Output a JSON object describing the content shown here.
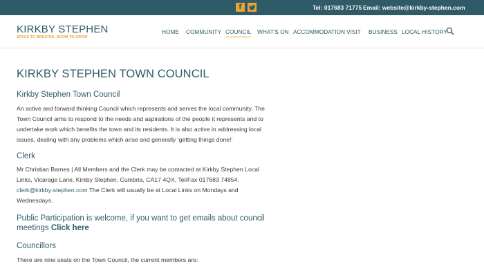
{
  "topbar": {
    "facebook_glyph": "f",
    "twitter_glyph": "t",
    "tel": "Tel: 017683 71775",
    "email": "Email: website@kirkby-stephen.com",
    "colors": {
      "bar": "#2f5b68",
      "icon_bg": "#e9a431"
    }
  },
  "header": {
    "logo_main": "KIRKBY STEPHEN",
    "logo_tagline": "SPACE TO BREATHE, ROOM TO GROW",
    "nav": [
      {
        "label": "HOME"
      },
      {
        "label": "COMMUNITY"
      },
      {
        "label": "COUNCIL",
        "active": true
      },
      {
        "label": "WHAT'S ON"
      },
      {
        "label": "ACCOMMODATION"
      },
      {
        "label": "VISIT"
      },
      {
        "label": "BUSINESS"
      },
      {
        "label": "LOCAL HISTORY"
      }
    ],
    "search_icon": "search-icon"
  },
  "main": {
    "page_title": "KIRKBY STEPHEN TOWN COUNCIL",
    "intro_heading": "Kirkby Stephen Town Council",
    "intro_lines": [
      "An active and forward thinking Council which represents and serves the local community. The",
      "Town Council aims to respond to the needs and aspirations of the people it represents and to",
      "undertake work which benefits the town and its residents. It is also active in addressing local",
      "issues, dealing with any problems which arise and generally ‘getting things done!’"
    ],
    "clerk_heading": "Clerk",
    "clerk_lines": [
      "Mr Christian Barnes | All Members and the Clerk may be contacted at Kirkby Stephen Local",
      "Links, Vicarage Lane, Kirkby Stephen, Cumbria, CA17 4QX, Tel/Fax 017683 74854,"
    ],
    "clerk_email": "clerk@kirkby-stephen.com",
    "clerk_after_email": " The Clerk will usually be at Local Links on Mondays and",
    "clerk_last_line": "Wednesdays.",
    "participation_text": "Public Participation is welcome, if you want to get emails about council meetings ",
    "participation_link": "Click here",
    "councillors_heading": "Councillors",
    "councillors_text": "There are nine seats on the Town Council, the current members are:"
  }
}
